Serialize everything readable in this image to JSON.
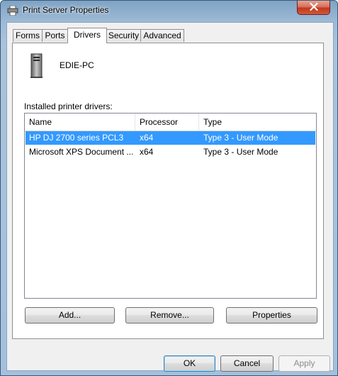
{
  "window": {
    "title": "Print Server Properties"
  },
  "tabs": [
    {
      "label": "Forms",
      "active": false
    },
    {
      "label": "Ports",
      "active": false
    },
    {
      "label": "Drivers",
      "active": true
    },
    {
      "label": "Security",
      "active": false
    },
    {
      "label": "Advanced",
      "active": false
    }
  ],
  "server": {
    "name": "EDIE-PC"
  },
  "drivers": {
    "label": "Installed printer drivers:",
    "columns": [
      "Name",
      "Processor",
      "Type"
    ],
    "rows": [
      {
        "name": "HP DJ 2700 series PCL3",
        "processor": "x64",
        "type": "Type 3 - User Mode",
        "selected": true
      },
      {
        "name": "Microsoft XPS Document ...",
        "processor": "x64",
        "type": "Type 3 - User Mode",
        "selected": false
      }
    ]
  },
  "actions": {
    "add": "Add...",
    "remove": "Remove...",
    "properties": "Properties"
  },
  "footer": {
    "ok": "OK",
    "cancel": "Cancel",
    "apply": "Apply"
  },
  "colors": {
    "selection": "#3399ff",
    "close_button": "#c0391e"
  }
}
